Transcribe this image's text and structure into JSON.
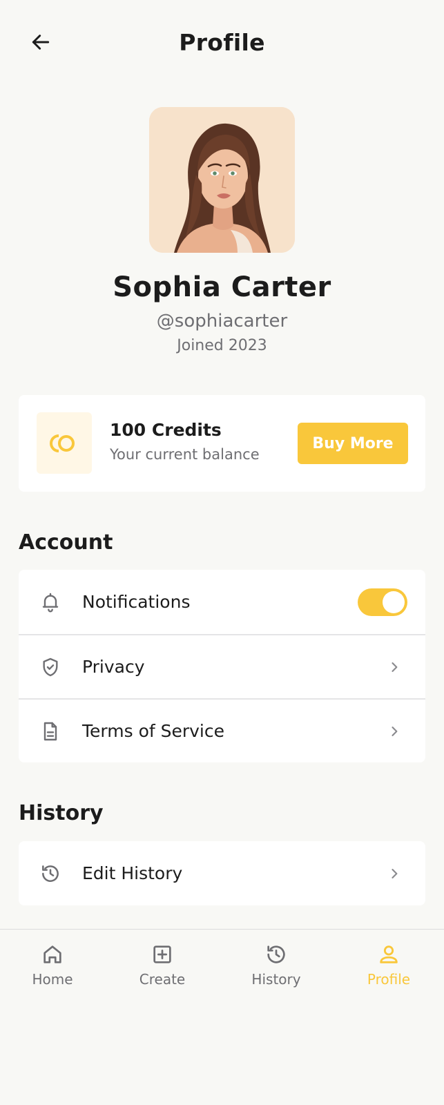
{
  "header": {
    "title": "Profile"
  },
  "profile": {
    "name": "Sophia Carter",
    "handle": "@sophiacarter",
    "joined": "Joined 2023"
  },
  "credits": {
    "title": "100 Credits",
    "subtitle": "Your current balance",
    "buy_label": "Buy More"
  },
  "sections": {
    "account_title": "Account",
    "account_items": [
      {
        "label": "Notifications",
        "icon": "bell-icon",
        "control": "toggle",
        "toggle_on": true
      },
      {
        "label": "Privacy",
        "icon": "shield-check-icon",
        "control": "chevron"
      },
      {
        "label": "Terms of Service",
        "icon": "document-icon",
        "control": "chevron"
      }
    ],
    "history_title": "History",
    "history_items": [
      {
        "label": "Edit History",
        "icon": "history-icon",
        "control": "chevron"
      }
    ]
  },
  "nav": {
    "items": [
      {
        "label": "Home",
        "icon": "home-icon",
        "active": false
      },
      {
        "label": "Create",
        "icon": "plus-square-icon",
        "active": false
      },
      {
        "label": "History",
        "icon": "history-icon",
        "active": false
      },
      {
        "label": "Profile",
        "icon": "user-icon",
        "active": true
      }
    ]
  },
  "colors": {
    "accent": "#f9c73b",
    "background": "#f8f8f5",
    "muted_text": "#6e6e72",
    "card": "#ffffff"
  }
}
